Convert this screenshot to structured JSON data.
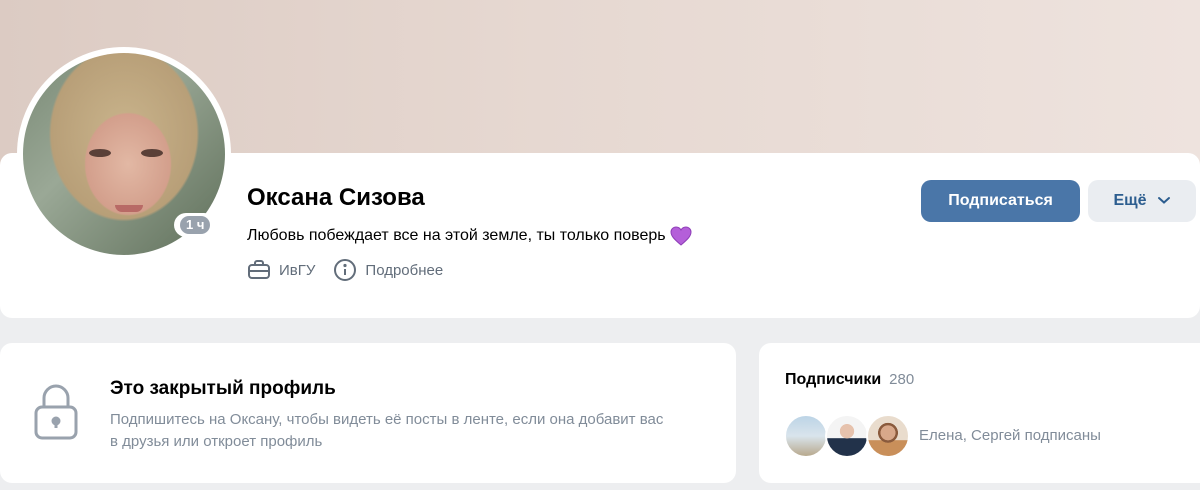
{
  "profile": {
    "name": "Оксана Сизова",
    "status": "Любовь побеждает все на этой земле, ты только поверь",
    "online": "1 ч",
    "education": "ИвГУ",
    "details_link": "Подробнее",
    "subscribe_button": "Подписаться",
    "more_button": "Ещё"
  },
  "closed_profile": {
    "title": "Это закрытый профиль",
    "description": "Подпишитесь на Оксану, чтобы видеть её посты в ленте, если она добавит вас в друзья или откроет профиль"
  },
  "followers": {
    "title": "Подписчики",
    "count": "280",
    "friends_text": "Елена, Сергей подписаны"
  },
  "icons": {
    "status_emoji": "purple-heart-icon",
    "education": "briefcase-icon",
    "details": "info-icon",
    "more": "chevron-down-icon",
    "closed": "lock-icon"
  },
  "colors": {
    "primary_button": "#4a76a8",
    "secondary_button": "#eaedf1",
    "secondary_text": "#818c99",
    "page_background": "#edeef0"
  }
}
